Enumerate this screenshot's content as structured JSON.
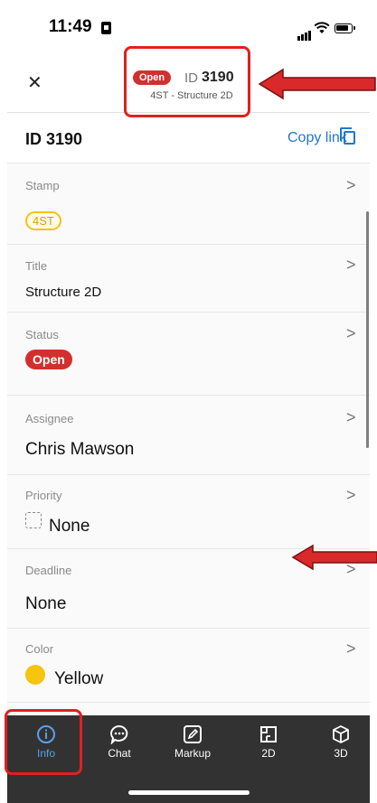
{
  "status_bar": {
    "time": "11:49"
  },
  "header": {
    "badge": "Open",
    "id_prefix": "ID",
    "id_number": "3190",
    "subtitle": "4ST - Structure 2D",
    "more": "•••"
  },
  "section": {
    "title": "ID 3190",
    "copy_link": "Copy link"
  },
  "fields": {
    "stamp": {
      "label": "Stamp",
      "value": "4ST"
    },
    "title": {
      "label": "Title",
      "value": "Structure 2D"
    },
    "status": {
      "label": "Status",
      "value": "Open"
    },
    "assignee": {
      "label": "Assignee",
      "value": "Chris Mawson"
    },
    "priority": {
      "label": "Priority",
      "value": "None"
    },
    "deadline": {
      "label": "Deadline",
      "value": "None"
    },
    "color": {
      "label": "Color",
      "value": "Yellow",
      "swatch": "#f7c40e"
    }
  },
  "nav": {
    "items": [
      {
        "label": "Info",
        "icon": "info-icon",
        "active": true
      },
      {
        "label": "Chat",
        "icon": "chat-icon"
      },
      {
        "label": "Markup",
        "icon": "markup-icon"
      },
      {
        "label": "2D",
        "icon": "plan-2d-icon"
      },
      {
        "label": "3D",
        "icon": "cube-3d-icon"
      }
    ]
  },
  "colors": {
    "accent": "#1e78d2",
    "open_red": "#d32f2f",
    "stamp_yellow": "#f2c31a",
    "nav_bg": "#323232",
    "annotation_red": "#e02020"
  }
}
